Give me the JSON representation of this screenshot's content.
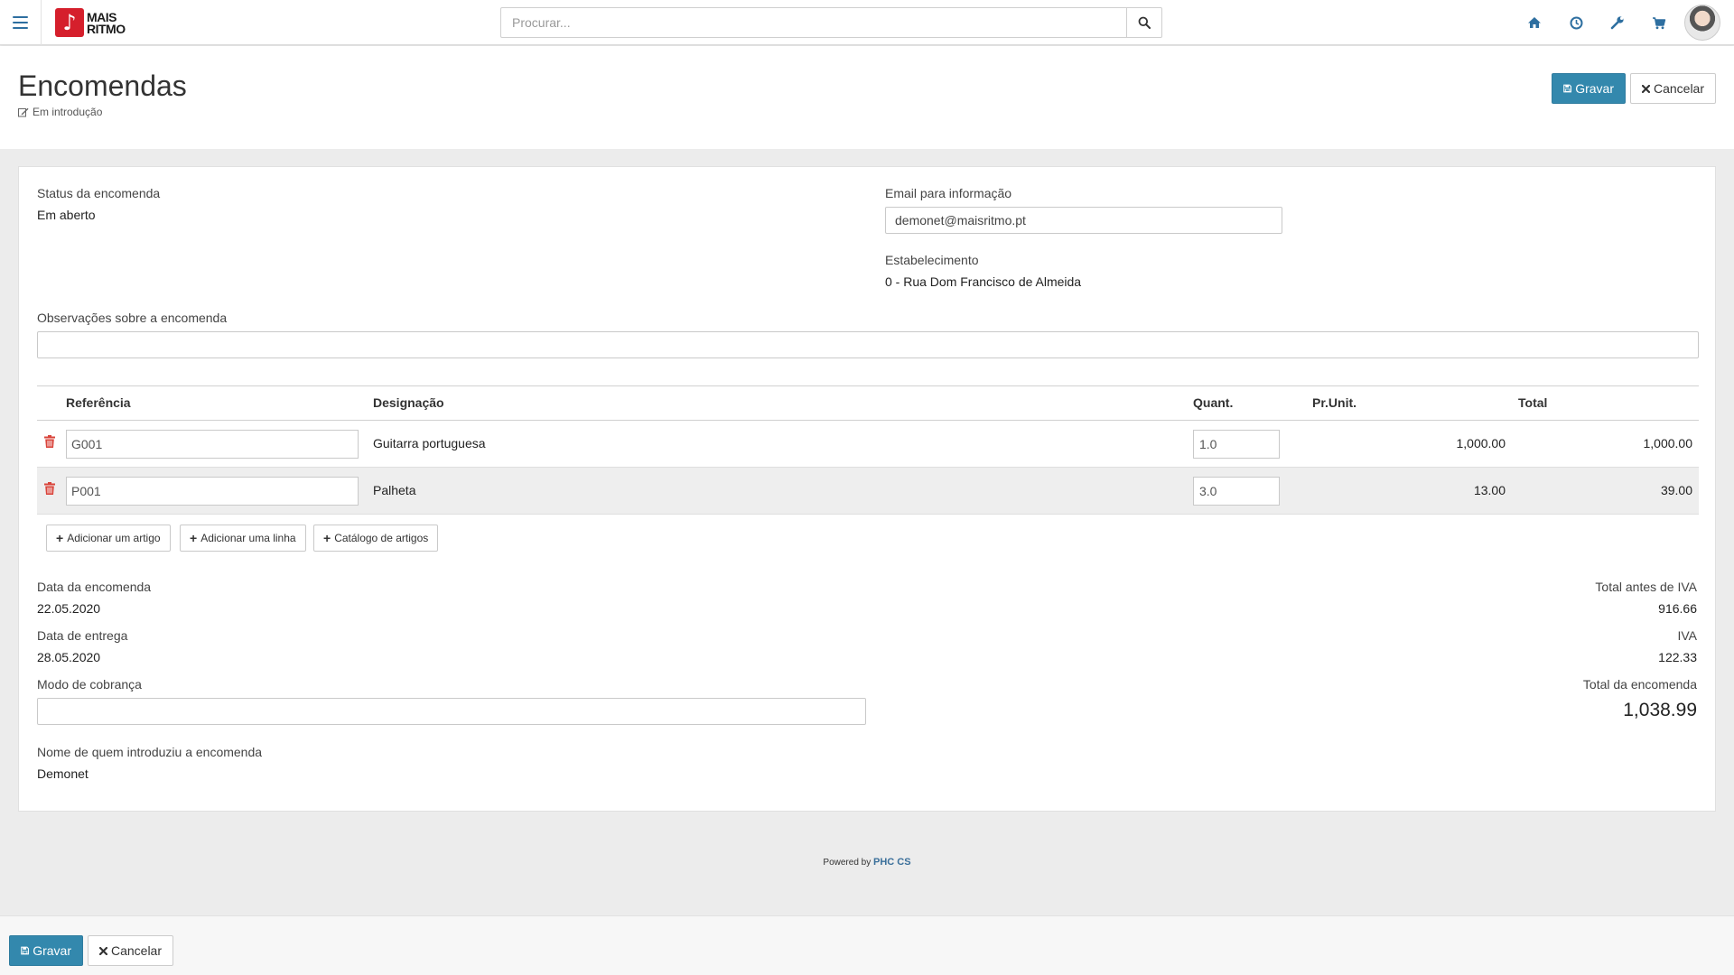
{
  "app": {
    "logo_line1": "MAIS",
    "logo_line2": "RITMO",
    "search_placeholder": "Procurar...",
    "icons": [
      "menu-icon",
      "search-icon",
      "home-icon",
      "clock-icon",
      "wrench-icon",
      "cart-icon",
      "user-avatar"
    ],
    "accent_color": "#3388ad",
    "brand_color": "#d51f2c"
  },
  "header": {
    "title": "Encomendas",
    "status": "Em introdução",
    "save_label": "Gravar",
    "cancel_label": "Cancelar"
  },
  "form": {
    "status_label": "Status da encomenda",
    "status_value": "Em aberto",
    "email_label": "Email para informação",
    "email_value": "demonet@maisritmo.pt",
    "establishment_label": "Estabelecimento",
    "establishment_value": "0 - Rua Dom Francisco de Almeida",
    "notes_label": "Observações sobre a encomenda",
    "notes_value": ""
  },
  "table": {
    "headers": {
      "ref": "Referência",
      "designation": "Designação",
      "qty": "Quant.",
      "unit_price": "Pr.Unit.",
      "total": "Total"
    },
    "rows": [
      {
        "ref": "G001",
        "designation": "Guitarra portuguesa",
        "qty": "1.0",
        "unit_price": "1,000.00",
        "total": "1,000.00"
      },
      {
        "ref": "P001",
        "designation": "Palheta",
        "qty": "3.0",
        "unit_price": "13.00",
        "total": "39.00"
      }
    ],
    "add_article": "Adicionar um artigo",
    "add_line": "Adicionar uma linha",
    "catalog": "Catálogo de artigos"
  },
  "details": {
    "order_date_label": "Data da encomenda",
    "order_date": "22.05.2020",
    "delivery_date_label": "Data de entrega",
    "delivery_date": "28.05.2020",
    "payment_label": "Modo de cobrança",
    "payment_value": "",
    "created_by_label": "Nome de quem introduziu a encomenda",
    "created_by": "Demonet"
  },
  "totals": {
    "before_vat_label": "Total antes de IVA",
    "before_vat": "916.66",
    "vat_label": "IVA",
    "vat": "122.33",
    "total_label": "Total da encomenda",
    "total": "1,038.99"
  },
  "footer": {
    "powered_by": "Powered by",
    "brand": "PHC CS",
    "save_label": "Gravar",
    "cancel_label": "Cancelar"
  }
}
